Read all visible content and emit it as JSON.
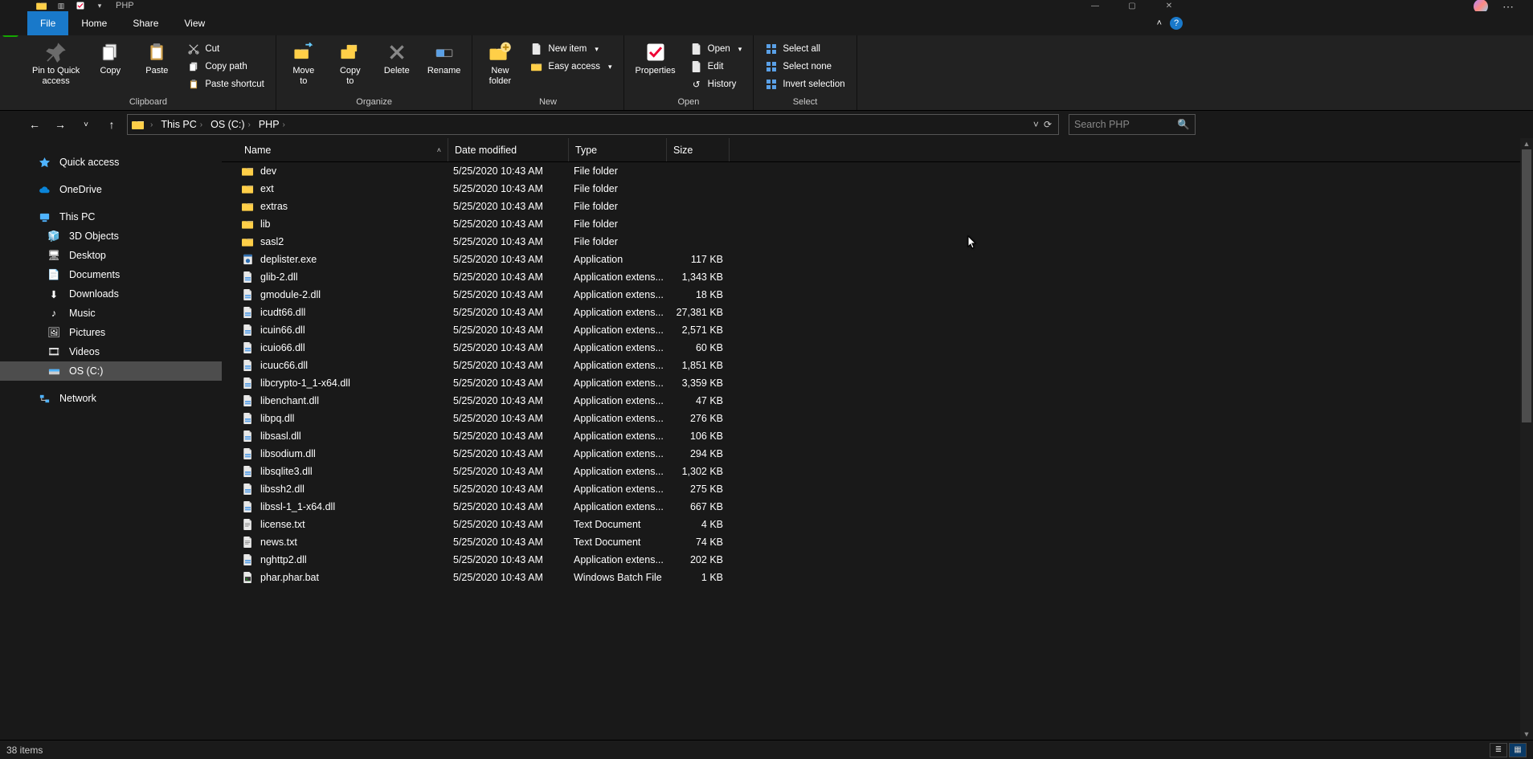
{
  "window": {
    "title": "PHP",
    "minimize": "—",
    "maximize": "▢",
    "close": "✕"
  },
  "tabs": {
    "file": "File",
    "home": "Home",
    "share": "Share",
    "view": "View"
  },
  "ribbon": {
    "clipboard": {
      "label": "Clipboard",
      "pin": "Pin to Quick\naccess",
      "copy": "Copy",
      "paste": "Paste",
      "cut": "Cut",
      "copy_path": "Copy path",
      "paste_shortcut": "Paste shortcut"
    },
    "organize": {
      "label": "Organize",
      "move_to": "Move\nto",
      "copy_to": "Copy\nto",
      "delete": "Delete",
      "rename": "Rename"
    },
    "new": {
      "label": "New",
      "new_folder": "New\nfolder",
      "new_item": "New item",
      "easy_access": "Easy access"
    },
    "open": {
      "label": "Open",
      "properties": "Properties",
      "open": "Open",
      "edit": "Edit",
      "history": "History"
    },
    "select": {
      "label": "Select",
      "select_all": "Select all",
      "select_none": "Select none",
      "invert": "Invert selection"
    }
  },
  "breadcrumb": {
    "seg1": "This PC",
    "seg2": "OS (C:)",
    "seg3": "PHP"
  },
  "search": {
    "placeholder": "Search PHP"
  },
  "sidebar": {
    "quick_access": "Quick access",
    "onedrive": "OneDrive",
    "this_pc": "This PC",
    "objects3d": "3D Objects",
    "desktop": "Desktop",
    "documents": "Documents",
    "downloads": "Downloads",
    "music": "Music",
    "pictures": "Pictures",
    "videos": "Videos",
    "os_c": "OS (C:)",
    "network": "Network"
  },
  "columns": {
    "name": "Name",
    "date": "Date modified",
    "type": "Type",
    "size": "Size"
  },
  "files": [
    {
      "icon": "folder",
      "name": "dev",
      "date": "5/25/2020 10:43 AM",
      "type": "File folder",
      "size": ""
    },
    {
      "icon": "folder",
      "name": "ext",
      "date": "5/25/2020 10:43 AM",
      "type": "File folder",
      "size": ""
    },
    {
      "icon": "folder",
      "name": "extras",
      "date": "5/25/2020 10:43 AM",
      "type": "File folder",
      "size": ""
    },
    {
      "icon": "folder",
      "name": "lib",
      "date": "5/25/2020 10:43 AM",
      "type": "File folder",
      "size": ""
    },
    {
      "icon": "folder",
      "name": "sasl2",
      "date": "5/25/2020 10:43 AM",
      "type": "File folder",
      "size": ""
    },
    {
      "icon": "exe",
      "name": "deplister.exe",
      "date": "5/25/2020 10:43 AM",
      "type": "Application",
      "size": "117 KB"
    },
    {
      "icon": "dll",
      "name": "glib-2.dll",
      "date": "5/25/2020 10:43 AM",
      "type": "Application extens...",
      "size": "1,343 KB"
    },
    {
      "icon": "dll",
      "name": "gmodule-2.dll",
      "date": "5/25/2020 10:43 AM",
      "type": "Application extens...",
      "size": "18 KB"
    },
    {
      "icon": "dll",
      "name": "icudt66.dll",
      "date": "5/25/2020 10:43 AM",
      "type": "Application extens...",
      "size": "27,381 KB"
    },
    {
      "icon": "dll",
      "name": "icuin66.dll",
      "date": "5/25/2020 10:43 AM",
      "type": "Application extens...",
      "size": "2,571 KB"
    },
    {
      "icon": "dll",
      "name": "icuio66.dll",
      "date": "5/25/2020 10:43 AM",
      "type": "Application extens...",
      "size": "60 KB"
    },
    {
      "icon": "dll",
      "name": "icuuc66.dll",
      "date": "5/25/2020 10:43 AM",
      "type": "Application extens...",
      "size": "1,851 KB"
    },
    {
      "icon": "dll",
      "name": "libcrypto-1_1-x64.dll",
      "date": "5/25/2020 10:43 AM",
      "type": "Application extens...",
      "size": "3,359 KB"
    },
    {
      "icon": "dll",
      "name": "libenchant.dll",
      "date": "5/25/2020 10:43 AM",
      "type": "Application extens...",
      "size": "47 KB"
    },
    {
      "icon": "dll",
      "name": "libpq.dll",
      "date": "5/25/2020 10:43 AM",
      "type": "Application extens...",
      "size": "276 KB"
    },
    {
      "icon": "dll",
      "name": "libsasl.dll",
      "date": "5/25/2020 10:43 AM",
      "type": "Application extens...",
      "size": "106 KB"
    },
    {
      "icon": "dll",
      "name": "libsodium.dll",
      "date": "5/25/2020 10:43 AM",
      "type": "Application extens...",
      "size": "294 KB"
    },
    {
      "icon": "dll",
      "name": "libsqlite3.dll",
      "date": "5/25/2020 10:43 AM",
      "type": "Application extens...",
      "size": "1,302 KB"
    },
    {
      "icon": "dll",
      "name": "libssh2.dll",
      "date": "5/25/2020 10:43 AM",
      "type": "Application extens...",
      "size": "275 KB"
    },
    {
      "icon": "dll",
      "name": "libssl-1_1-x64.dll",
      "date": "5/25/2020 10:43 AM",
      "type": "Application extens...",
      "size": "667 KB"
    },
    {
      "icon": "txt",
      "name": "license.txt",
      "date": "5/25/2020 10:43 AM",
      "type": "Text Document",
      "size": "4 KB"
    },
    {
      "icon": "txt",
      "name": "news.txt",
      "date": "5/25/2020 10:43 AM",
      "type": "Text Document",
      "size": "74 KB"
    },
    {
      "icon": "dll",
      "name": "nghttp2.dll",
      "date": "5/25/2020 10:43 AM",
      "type": "Application extens...",
      "size": "202 KB"
    },
    {
      "icon": "bat",
      "name": "phar.phar.bat",
      "date": "5/25/2020 10:43 AM",
      "type": "Windows Batch File",
      "size": "1 KB"
    }
  ],
  "status": {
    "items": "38 items"
  }
}
